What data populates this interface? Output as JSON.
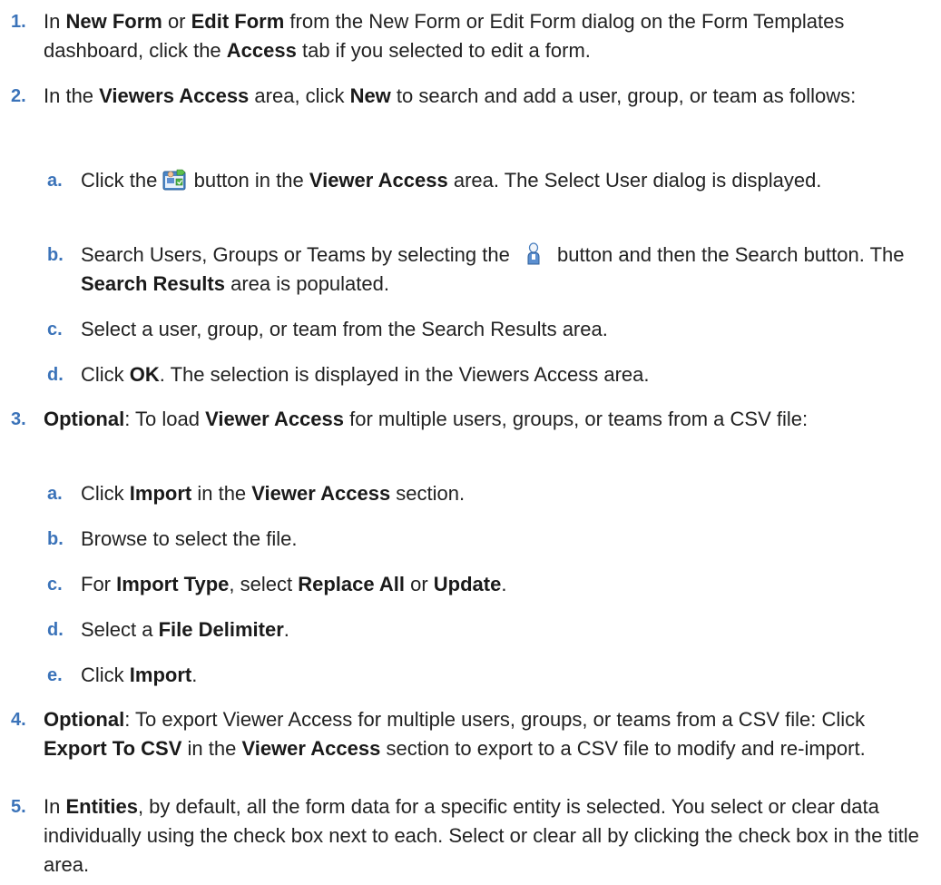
{
  "steps": [
    {
      "num": "1.",
      "t1": "In ",
      "b1": "New Form",
      "t2": " or ",
      "b2": "Edit Form",
      "t3": " from the New Form or Edit Form dialog on the Form Templates dashboard, click the ",
      "b3": "Access",
      "t4": " tab if you selected to edit a form."
    },
    {
      "num": "2.",
      "t1": "In the ",
      "b1": "Viewers Access",
      "t2": " area, click ",
      "b2": "New",
      "t3": " to search and add a user, group, or team as follows:",
      "subs": [
        {
          "let": "a.",
          "t1": "Click the ",
          "icon": "add-user-icon",
          "t2": " button in the ",
          "b1": "Viewer Access",
          "t3": " area. The Select User dialog is displayed."
        },
        {
          "let": "b.",
          "t1": "Search Users, Groups or Teams by selecting the ",
          "icon": "user-icon",
          "t2": " button and then the Search button. The ",
          "b1": "Search Results",
          "t3": " area is populated."
        },
        {
          "let": "c.",
          "t1": "Select a user, group, or team from the Search Results area."
        },
        {
          "let": "d.",
          "t1": "Click ",
          "b1": "OK",
          "t2": ". The selection is displayed in the Viewers Access area."
        }
      ]
    },
    {
      "num": "3.",
      "b1": "Optional",
      "t1": ": To load ",
      "b2": "Viewer Access",
      "t2": " for multiple users, groups, or teams from a CSV file:",
      "subs": [
        {
          "let": "a.",
          "t1": "Click ",
          "b1": "Import",
          "t2": " in the ",
          "b2": "Viewer Access",
          "t3": " section."
        },
        {
          "let": "b.",
          "t1": "Browse to select the file."
        },
        {
          "let": "c.",
          "t1": "For ",
          "b1": "Import Type",
          "t2": ", select ",
          "b2": "Replace All",
          "t3": " or ",
          "b3": "Update",
          "t4": "."
        },
        {
          "let": "d.",
          "t1": "Select a ",
          "b1": "File Delimiter",
          "t2": "."
        },
        {
          "let": "e.",
          "t1": "Click ",
          "b1": "Import",
          "t2": "."
        }
      ]
    },
    {
      "num": "4.",
      "b1": "Optional",
      "t1": ": To export Viewer Access for multiple users, groups, or teams from a CSV file: Click ",
      "b2": "Export To CSV",
      "t2": " in the ",
      "b3": "Viewer Access",
      "t3": " section to export to a CSV file to modify and re-import."
    },
    {
      "num": "5.",
      "t1": "In ",
      "b1": "Entities",
      "t2": ", by default, all the form data for a specific entity is selected. You select or clear data individually using the check box next to each. Select or clear all by clicking the check box in the title area."
    }
  ]
}
